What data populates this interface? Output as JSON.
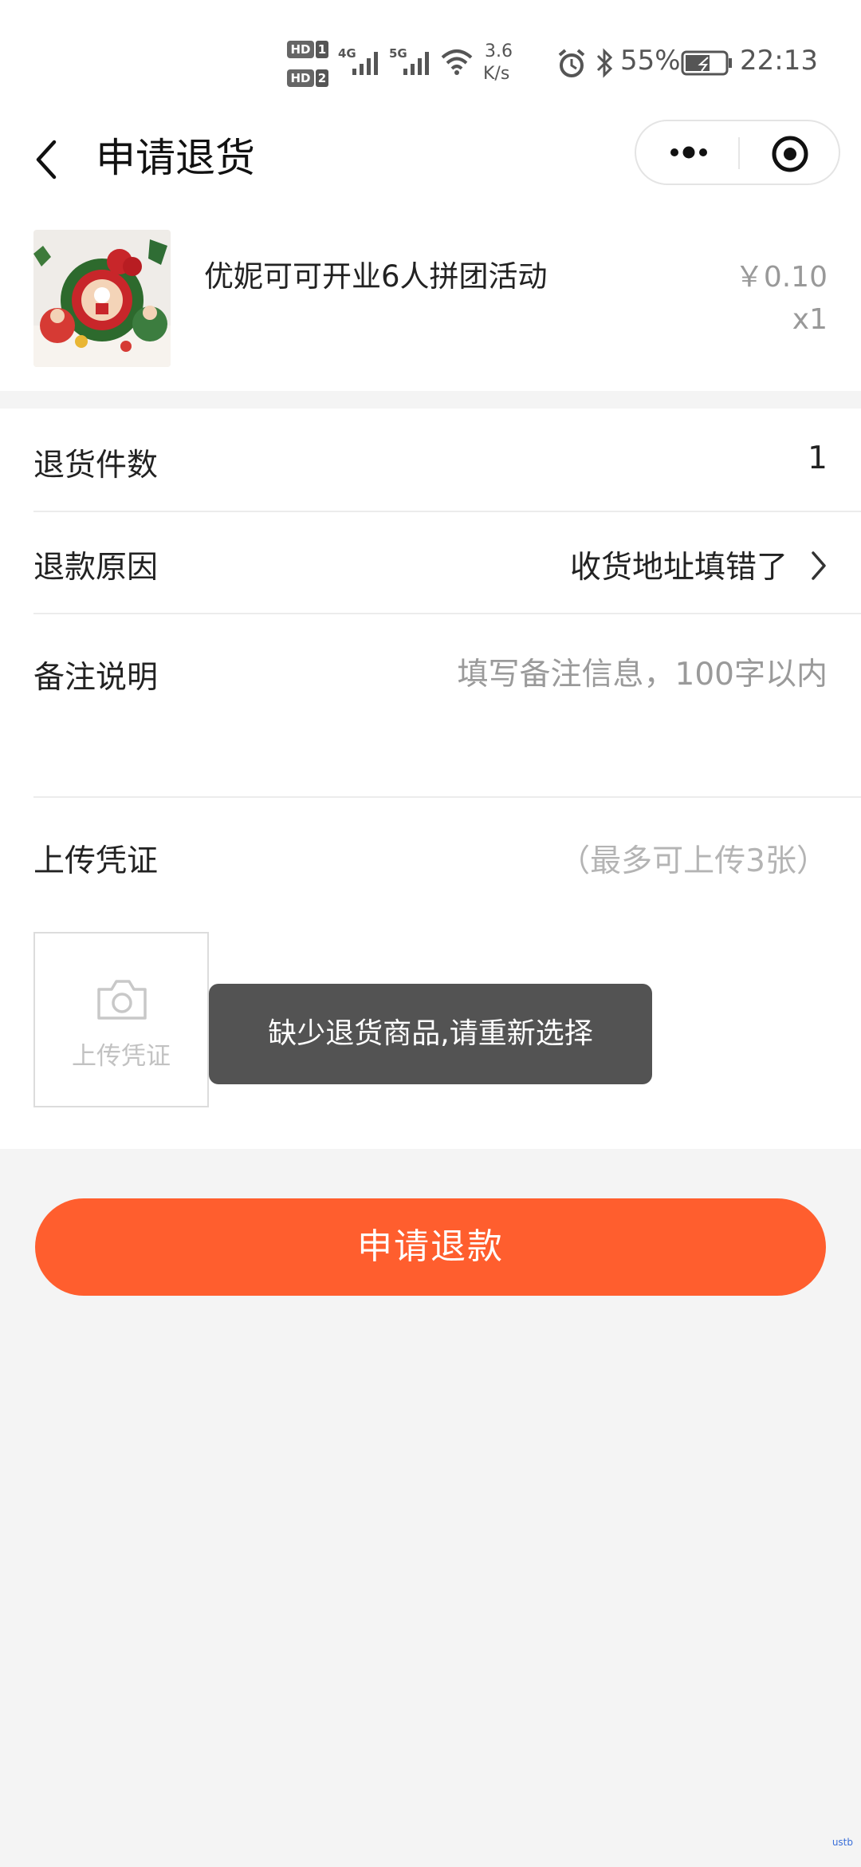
{
  "status_bar": {
    "hd1": "HD",
    "hd1_num": "1",
    "hd2": "HD",
    "hd2_num": "2",
    "net1": "4G",
    "net2": "5G",
    "speed_value": "3.6",
    "speed_unit": "K/s",
    "battery": "55%",
    "time": "22:13",
    "icons": [
      "signal-icon",
      "wifi-icon",
      "alarm-icon",
      "bluetooth-icon",
      "battery-icon"
    ]
  },
  "nav": {
    "back_icon": "chevron-left-icon",
    "title": "申请退货",
    "more_icon": "more-dots-icon",
    "close_icon": "target-circle-icon"
  },
  "product": {
    "name": "优妮可可开业6人拼团活动",
    "price": "￥0.10",
    "quantity": "x1",
    "image": "christmas-decoration-thumbnail"
  },
  "form": {
    "return_count_label": "退货件数",
    "return_count_value": "1",
    "reason_label": "退款原因",
    "reason_value": "收货地址填错了",
    "remark_label": "备注说明",
    "remark_placeholder": "填写备注信息，100字以内",
    "voucher_label": "上传凭证",
    "voucher_hint": "（最多可上传3张）",
    "upload_button_label": "上传凭证"
  },
  "toast": {
    "message": "缺少退货商品,请重新选择"
  },
  "submit": {
    "label": "申请退款"
  },
  "watermark": "ustb",
  "colors": {
    "accent": "#ff5e2e",
    "toast_bg": "#4a4a4a",
    "page_bg": "#f4f4f4"
  }
}
